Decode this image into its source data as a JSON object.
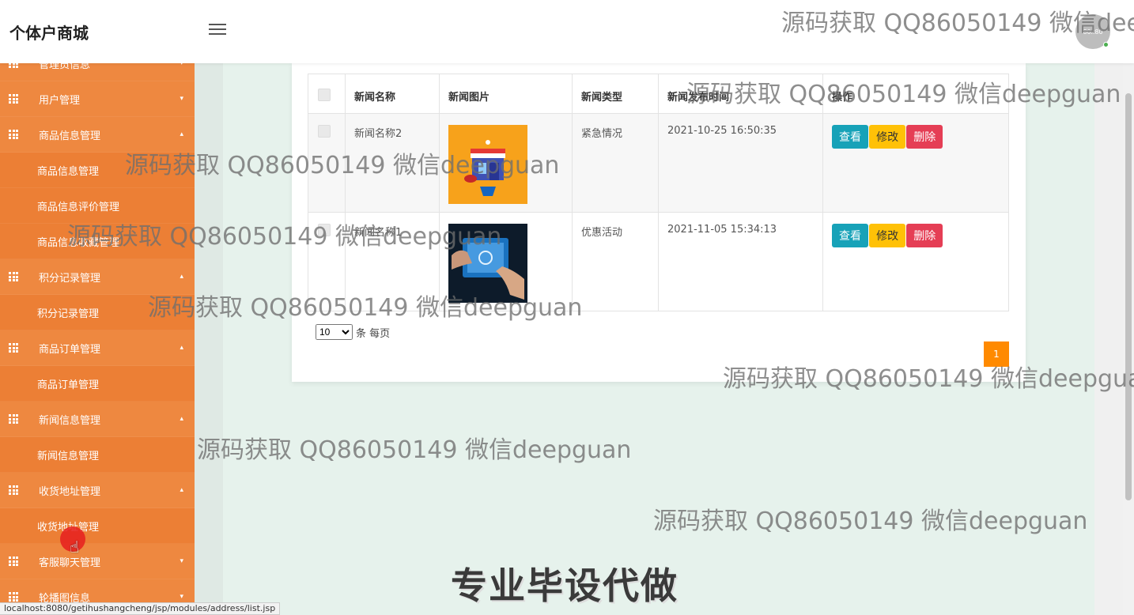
{
  "header": {
    "brand": "个体户商城",
    "avatar_text": "80x80"
  },
  "sidebar": {
    "items": [
      {
        "type": "parent",
        "label": "管理员信息",
        "caret": "▾"
      },
      {
        "type": "parent",
        "label": "用户管理",
        "caret": "▾"
      },
      {
        "type": "parent",
        "label": "商品信息管理",
        "caret": "▴"
      },
      {
        "type": "child",
        "label": "商品信息管理"
      },
      {
        "type": "child",
        "label": "商品信息评价管理"
      },
      {
        "type": "child",
        "label": "商品信息收藏管理"
      },
      {
        "type": "parent",
        "label": "积分记录管理",
        "caret": "▴"
      },
      {
        "type": "child",
        "label": "积分记录管理"
      },
      {
        "type": "parent",
        "label": "商品订单管理",
        "caret": "▴"
      },
      {
        "type": "child",
        "label": "商品订单管理"
      },
      {
        "type": "parent",
        "label": "新闻信息管理",
        "caret": "▴"
      },
      {
        "type": "child",
        "label": "新闻信息管理"
      },
      {
        "type": "parent",
        "label": "收货地址管理",
        "caret": "▴"
      },
      {
        "type": "child",
        "label": "收货地址管理"
      },
      {
        "type": "parent",
        "label": "客服聊天管理",
        "caret": "▾"
      },
      {
        "type": "parent",
        "label": "轮播图信息",
        "caret": "▾"
      }
    ]
  },
  "table": {
    "headers": [
      "新闻名称",
      "新闻图片",
      "新闻类型",
      "新闻发布时间",
      "操作"
    ],
    "rows": [
      {
        "name": "新闻名称2",
        "type": "紧急情况",
        "time": "2021-10-25 16:50:35",
        "image": "storefront-image"
      },
      {
        "name": "新闻名称1",
        "type": "优惠活动",
        "time": "2021-11-05 15:34:13",
        "image": "tablet-touch-image"
      }
    ],
    "actions": {
      "view": "查看",
      "edit": "修改",
      "delete": "删除"
    }
  },
  "pagination": {
    "page_size": "10",
    "page_size_options": [
      "10"
    ],
    "page_size_suffix": "条 每页",
    "current_page": "1"
  },
  "statusbar": {
    "url": "localhost:8080/getihushangcheng/jsp/modules/address/list.jsp"
  },
  "watermarks": {
    "text": "源码获取 QQ86050149 微信deepguan",
    "big_text": "专业毕设代做"
  },
  "colors": {
    "sidebar": "#ec7f35",
    "view_button": "#17a2b8",
    "edit_button": "#ffc107",
    "delete_button": "#e53e55",
    "pagination": "#ff8a00"
  }
}
